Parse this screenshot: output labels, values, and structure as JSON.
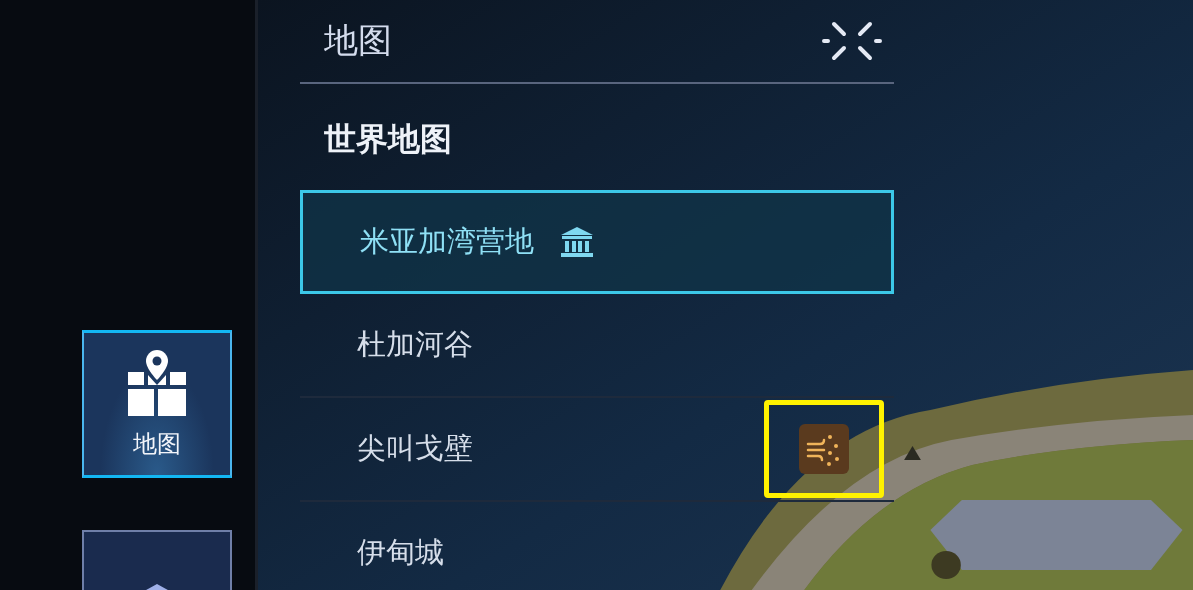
{
  "sidebar": {
    "items": [
      {
        "kind": "map",
        "label": "地图",
        "selected": true
      },
      {
        "kind": "museum",
        "selected": false
      }
    ]
  },
  "panel": {
    "title": "地图",
    "section": "世界地图",
    "rows": [
      {
        "kind": "camp",
        "label": "米亚加湾营地",
        "selected": true,
        "highlighted": false
      },
      {
        "kind": "plain",
        "label": "杜加河谷",
        "selected": false,
        "highlighted": false
      },
      {
        "kind": "wind",
        "label": "尖叫戈壁",
        "selected": false,
        "highlighted": true
      },
      {
        "kind": "plain",
        "label": "伊甸城",
        "selected": false,
        "highlighted": false
      }
    ]
  }
}
